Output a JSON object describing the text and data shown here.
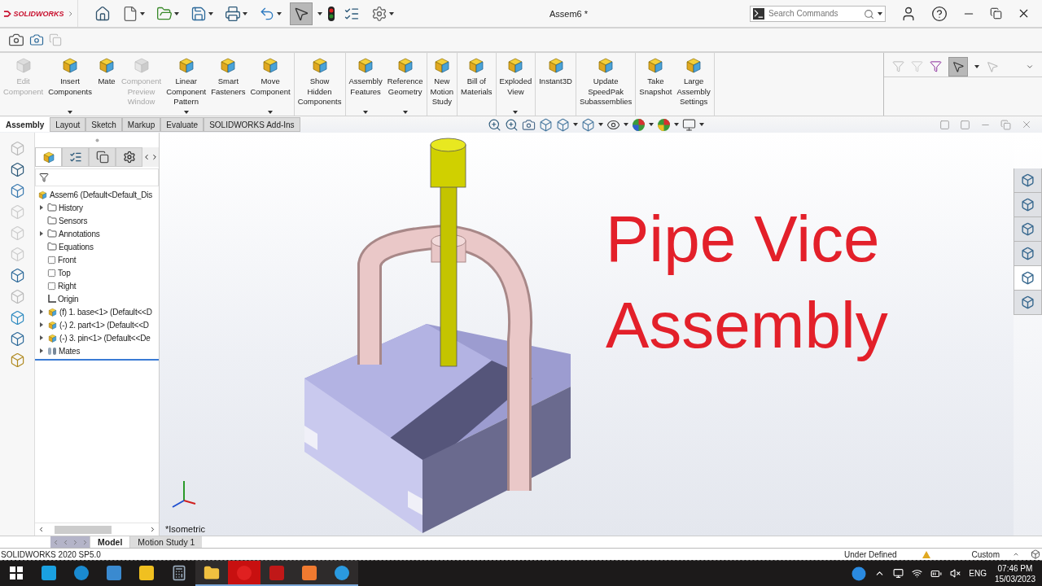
{
  "app": {
    "logo": "SOLIDWORKS",
    "title": "Assem6 *",
    "search": {
      "placeholder": "Search Commands"
    }
  },
  "ribbon_groups": [
    {
      "buttons": [
        {
          "lines": [
            "Edit",
            "Component"
          ],
          "disabled": true,
          "dropdown": false
        },
        {
          "lines": [
            "Insert",
            "Components"
          ],
          "disabled": false,
          "dropdown": true
        },
        {
          "lines": [
            "Mate"
          ],
          "disabled": false,
          "dropdown": false
        },
        {
          "lines": [
            "Component",
            "Preview",
            "Window"
          ],
          "disabled": true,
          "dropdown": false
        },
        {
          "lines": [
            "Linear",
            "Component",
            "Pattern"
          ],
          "disabled": false,
          "dropdown": true
        },
        {
          "lines": [
            "Smart",
            "Fasteners"
          ],
          "disabled": false,
          "dropdown": false
        },
        {
          "lines": [
            "Move",
            "Component"
          ],
          "disabled": false,
          "dropdown": true
        }
      ]
    },
    {
      "buttons": [
        {
          "lines": [
            "Show",
            "Hidden",
            "Components"
          ],
          "disabled": false,
          "dropdown": false
        }
      ]
    },
    {
      "buttons": [
        {
          "lines": [
            "Assembly",
            "Features"
          ],
          "disabled": false,
          "dropdown": true
        },
        {
          "lines": [
            "Reference",
            "Geometry"
          ],
          "disabled": false,
          "dropdown": true
        }
      ]
    },
    {
      "buttons": [
        {
          "lines": [
            "New",
            "Motion",
            "Study"
          ],
          "disabled": false,
          "dropdown": false
        }
      ]
    },
    {
      "buttons": [
        {
          "lines": [
            "Bill of",
            "Materials"
          ],
          "disabled": false,
          "dropdown": false
        }
      ]
    },
    {
      "buttons": [
        {
          "lines": [
            "Exploded",
            "View"
          ],
          "disabled": false,
          "dropdown": true
        }
      ]
    },
    {
      "buttons": [
        {
          "lines": [
            "Instant3D"
          ],
          "disabled": false,
          "dropdown": false
        }
      ]
    },
    {
      "buttons": [
        {
          "lines": [
            "Update",
            "SpeedPak",
            "Subassemblies"
          ],
          "disabled": false,
          "dropdown": false
        }
      ]
    },
    {
      "buttons": [
        {
          "lines": [
            "Take",
            "Snapshot"
          ],
          "disabled": false,
          "dropdown": false
        },
        {
          "lines": [
            "Large",
            "Assembly",
            "Settings"
          ],
          "disabled": false,
          "dropdown": false
        }
      ]
    }
  ],
  "ribbon_tabs": [
    {
      "label": "Assembly",
      "selected": true
    },
    {
      "label": "Layout",
      "selected": false
    },
    {
      "label": "Sketch",
      "selected": false
    },
    {
      "label": "Markup",
      "selected": false
    },
    {
      "label": "Evaluate",
      "selected": false
    },
    {
      "label": "SOLIDWORKS Add-Ins",
      "selected": false
    }
  ],
  "tree_tabs": [
    {
      "selected": true
    },
    {
      "selected": false
    },
    {
      "selected": false
    },
    {
      "selected": false
    }
  ],
  "tree": {
    "root": "Assem6  (Default<Default_Dis",
    "items": [
      {
        "label": "History",
        "kind": "folder",
        "expandable": true
      },
      {
        "label": "Sensors",
        "kind": "folder",
        "expandable": false
      },
      {
        "label": "Annotations",
        "kind": "folder",
        "expandable": true
      },
      {
        "label": "Equations",
        "kind": "folder",
        "expandable": false
      },
      {
        "label": "Front",
        "kind": "plane",
        "expandable": false
      },
      {
        "label": "Top",
        "kind": "plane",
        "expandable": false
      },
      {
        "label": "Right",
        "kind": "plane",
        "expandable": false
      },
      {
        "label": "Origin",
        "kind": "origin",
        "expandable": false
      },
      {
        "label": "(f) 1. base<1> (Default<<D",
        "kind": "part",
        "expandable": true
      },
      {
        "label": "(-) 2. part<1> (Default<<D",
        "kind": "part",
        "expandable": true
      },
      {
        "label": "(-) 3. pin<1> (Default<<De",
        "kind": "part",
        "expandable": true
      },
      {
        "label": "Mates",
        "kind": "mates",
        "expandable": true
      }
    ]
  },
  "viewport": {
    "overlay_lines": [
      "Pipe Vice",
      "Assembly"
    ],
    "view_label": "*Isometric"
  },
  "task_pane": [
    {
      "selected": false
    },
    {
      "selected": false
    },
    {
      "selected": false
    },
    {
      "selected": false
    },
    {
      "selected": true
    },
    {
      "selected": false
    }
  ],
  "bottom_tabs": [
    {
      "label": "Model",
      "selected": true
    },
    {
      "label": "Motion Study 1",
      "selected": false
    }
  ],
  "status_bar": {
    "version": "SOLIDWORKS 2020 SP5.0",
    "state": "Under Defined",
    "units": "Custom"
  },
  "taskbar": {
    "apps": [
      {
        "running": false,
        "active": false
      },
      {
        "running": false,
        "active": false
      },
      {
        "running": false,
        "active": false
      },
      {
        "running": false,
        "active": false
      },
      {
        "running": false,
        "active": false
      },
      {
        "running": true,
        "active": false
      },
      {
        "running": true,
        "active": true
      },
      {
        "running": true,
        "active": false
      },
      {
        "running": true,
        "active": false
      },
      {
        "running": true,
        "active": false
      }
    ],
    "language": "ENG",
    "time": "07:46 PM",
    "date": "15/03/2023"
  }
}
